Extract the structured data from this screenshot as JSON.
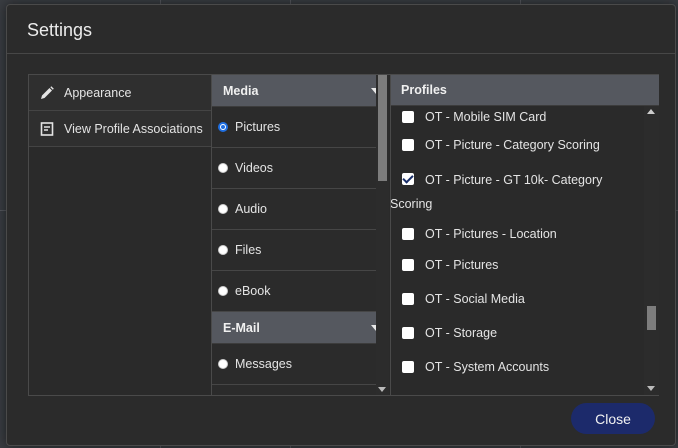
{
  "dialog": {
    "title": "Settings"
  },
  "nav": {
    "items": [
      {
        "label": "Appearance",
        "icon": "pencil-icon"
      },
      {
        "label": "View Profile Associations",
        "icon": "document-icon"
      }
    ]
  },
  "media": {
    "sections": [
      {
        "header": "Media",
        "options": [
          "Pictures",
          "Videos",
          "Audio",
          "Files",
          "eBook"
        ]
      },
      {
        "header": "E-Mail",
        "options": [
          "Messages"
        ]
      }
    ],
    "selected": "Pictures"
  },
  "profiles": {
    "header": "Profiles",
    "items": [
      {
        "label": "OT - Mobile SIM Card",
        "checked": false
      },
      {
        "label": "OT - Picture - Category Scoring",
        "checked": false
      },
      {
        "label": "OT - Picture - GT 10k- Category",
        "label_wrap": "Scoring",
        "checked": true
      },
      {
        "label": "OT - Pictures - Location",
        "checked": false
      },
      {
        "label": "OT - Pictures",
        "checked": false
      },
      {
        "label": "OT - Social Media",
        "checked": false
      },
      {
        "label": "OT - Storage",
        "checked": false
      },
      {
        "label": "OT - System Accounts",
        "checked": false
      }
    ]
  },
  "footer": {
    "close_label": "Close"
  },
  "colors": {
    "accent": "#1c2a6b",
    "header_bg": "#55585f",
    "dialog_bg": "#2b2b2b"
  }
}
